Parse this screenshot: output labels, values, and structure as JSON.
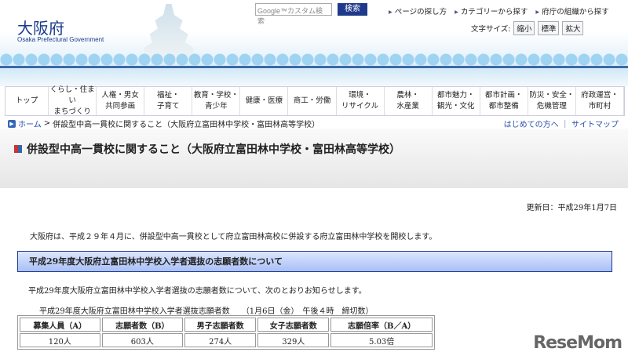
{
  "header": {
    "logo": "大阪府",
    "logo_sub": "Osaka Prefectural Government",
    "search_placeholder": "Google™カスタム検索",
    "search_button": "検索",
    "top_links": [
      "ページの探し方",
      "カテゴリーから探す",
      "府庁の組織から探す"
    ],
    "font_size_label": "文字サイズ:",
    "font_sizes": [
      "縮小",
      "標準",
      "拡大"
    ]
  },
  "nav": [
    "トップ",
    "くらし・住まい\nまちづくり",
    "人権・男女\n共同参画",
    "福祉・\n子育て",
    "教育・学校・\n青少年",
    "健康・医療",
    "商工・労働",
    "環境・\nリサイクル",
    "農林・\n水産業",
    "都市魅力・\n観光・文化",
    "都市計画・\n都市整備",
    "防災・安全・\n危機管理",
    "府政運営・\n市町村"
  ],
  "breadcrumb": {
    "home": "ホーム",
    "sep": ">",
    "current": "併設型中高一貫校に関すること（大阪府立富田林中学校・富田林高等学校）",
    "first_time": "はじめての方へ",
    "sitemap": "サイトマップ"
  },
  "page_title": "併設型中高一貫校に関すること（大阪府立富田林中学校・富田林高等学校）",
  "updated": "更新日：平成29年1月7日",
  "intro": "大阪府は、平成２９年４月に、併設型中高一貫校として府立富田林高校に併設する府立富田林中学校を開校します。",
  "section_heading": "平成29年度大阪府立富田林中学校入学者選抜の志願者数について",
  "section_text": "平成29年度大阪府立富田林中学校入学者選抜の志願者数について、次のとおりお知らせします。",
  "table": {
    "caption": "平成29年度大阪府立富田林中学校入学者選抜志願者数　　（1月6日（金）　午後４時　締切数）",
    "headers": [
      "募集人員（A）",
      "志願者数（B）",
      "男子志願者数",
      "女子志願者数",
      "志願倍率（B／A）"
    ],
    "row": [
      "120人",
      "603人",
      "274人",
      "329人",
      "5.03倍"
    ]
  },
  "watermark": "ReseMom"
}
